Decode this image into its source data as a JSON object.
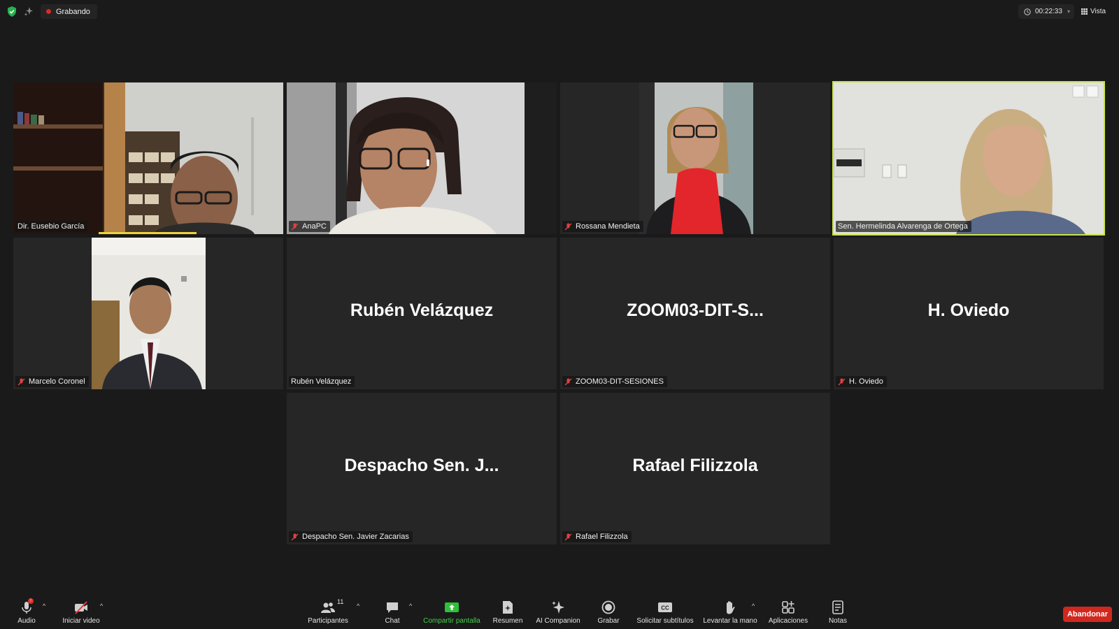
{
  "topbar": {
    "recording_label": "Grabando",
    "timer": "00:22:33",
    "view_label": "Vista"
  },
  "tiles": [
    {
      "name": "Dir. Eusebio García"
    },
    {
      "name": "AnaPC"
    },
    {
      "name": "Rossana Mendieta"
    },
    {
      "name": "Sen. Hermelinda Alvarenga de Ortega"
    },
    {
      "name": "Marcelo Coronel"
    },
    {
      "display": "Rubén Velázquez",
      "name": "Rubén Velázquez"
    },
    {
      "display": "ZOOM03-DIT-S...",
      "name": "ZOOM03-DIT-SESIONES"
    },
    {
      "display": "H. Oviedo",
      "name": "H. Oviedo"
    },
    {
      "display": "Despacho Sen. J...",
      "name": "Despacho Sen. Javier Zacarias"
    },
    {
      "display": "Rafael Filizzola",
      "name": "Rafael Filizzola"
    }
  ],
  "toolbar": {
    "audio": "Audio",
    "video": "Iniciar video",
    "participants": "Participantes",
    "participants_count": "11",
    "chat": "Chat",
    "share": "Compartir pantalla",
    "summary": "Resumen",
    "ai": "AI Companion",
    "record": "Grabar",
    "captions": "Solicitar subtítulos",
    "raise_hand": "Levantar la mano",
    "apps": "Aplicaciones",
    "notes": "Notas",
    "leave": "Abandonar",
    "audio_badge": "!"
  },
  "colors": {
    "background": "#1a1a1a",
    "tile": "#262626",
    "active_border": "#c9e24a",
    "share_green": "#43d24a",
    "leave_red": "#d0281f",
    "recording_red": "#e02828"
  }
}
